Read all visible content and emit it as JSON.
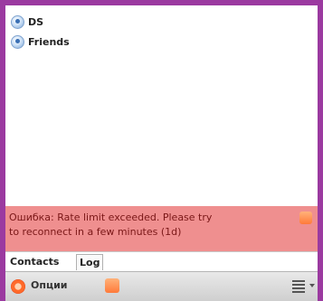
{
  "contacts": {
    "groups": [
      {
        "label": "DS"
      },
      {
        "label": "Friends"
      }
    ]
  },
  "error": {
    "line1": "Ошибка: Rate limit exceeded. Please try",
    "line2": "to reconnect in a few minutes  (1d)"
  },
  "tabs": [
    {
      "label": "Contacts"
    },
    {
      "label": "Log"
    }
  ],
  "toolbar": {
    "options_label": "Опции"
  },
  "colors": {
    "frame": "#9b3aa0",
    "error_bg": "#ef8f8f",
    "accent": "#ff7a3a"
  }
}
